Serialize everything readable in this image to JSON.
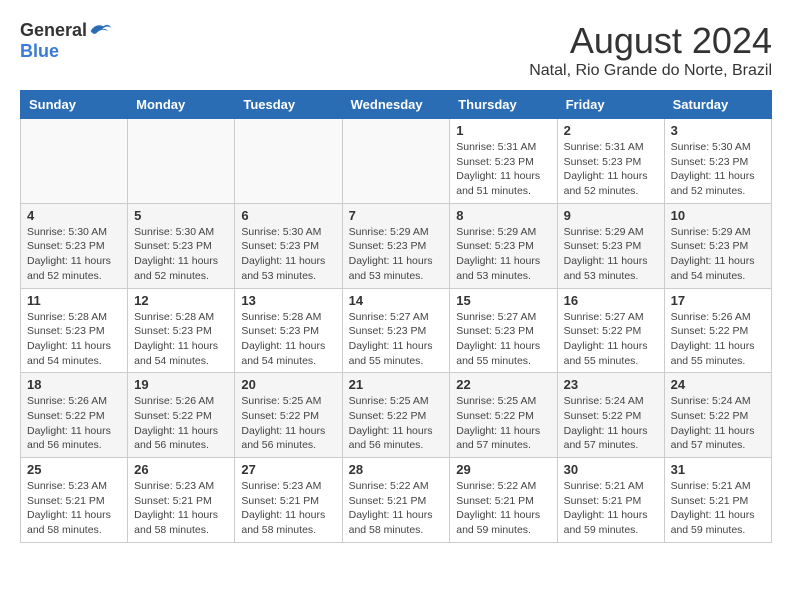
{
  "header": {
    "logo_general": "General",
    "logo_blue": "Blue",
    "month_year": "August 2024",
    "location": "Natal, Rio Grande do Norte, Brazil"
  },
  "calendar": {
    "headers": [
      "Sunday",
      "Monday",
      "Tuesday",
      "Wednesday",
      "Thursday",
      "Friday",
      "Saturday"
    ],
    "weeks": [
      [
        {
          "day": "",
          "info": ""
        },
        {
          "day": "",
          "info": ""
        },
        {
          "day": "",
          "info": ""
        },
        {
          "day": "",
          "info": ""
        },
        {
          "day": "1",
          "info": "Sunrise: 5:31 AM\nSunset: 5:23 PM\nDaylight: 11 hours and 51 minutes."
        },
        {
          "day": "2",
          "info": "Sunrise: 5:31 AM\nSunset: 5:23 PM\nDaylight: 11 hours and 52 minutes."
        },
        {
          "day": "3",
          "info": "Sunrise: 5:30 AM\nSunset: 5:23 PM\nDaylight: 11 hours and 52 minutes."
        }
      ],
      [
        {
          "day": "4",
          "info": "Sunrise: 5:30 AM\nSunset: 5:23 PM\nDaylight: 11 hours and 52 minutes."
        },
        {
          "day": "5",
          "info": "Sunrise: 5:30 AM\nSunset: 5:23 PM\nDaylight: 11 hours and 52 minutes."
        },
        {
          "day": "6",
          "info": "Sunrise: 5:30 AM\nSunset: 5:23 PM\nDaylight: 11 hours and 53 minutes."
        },
        {
          "day": "7",
          "info": "Sunrise: 5:29 AM\nSunset: 5:23 PM\nDaylight: 11 hours and 53 minutes."
        },
        {
          "day": "8",
          "info": "Sunrise: 5:29 AM\nSunset: 5:23 PM\nDaylight: 11 hours and 53 minutes."
        },
        {
          "day": "9",
          "info": "Sunrise: 5:29 AM\nSunset: 5:23 PM\nDaylight: 11 hours and 53 minutes."
        },
        {
          "day": "10",
          "info": "Sunrise: 5:29 AM\nSunset: 5:23 PM\nDaylight: 11 hours and 54 minutes."
        }
      ],
      [
        {
          "day": "11",
          "info": "Sunrise: 5:28 AM\nSunset: 5:23 PM\nDaylight: 11 hours and 54 minutes."
        },
        {
          "day": "12",
          "info": "Sunrise: 5:28 AM\nSunset: 5:23 PM\nDaylight: 11 hours and 54 minutes."
        },
        {
          "day": "13",
          "info": "Sunrise: 5:28 AM\nSunset: 5:23 PM\nDaylight: 11 hours and 54 minutes."
        },
        {
          "day": "14",
          "info": "Sunrise: 5:27 AM\nSunset: 5:23 PM\nDaylight: 11 hours and 55 minutes."
        },
        {
          "day": "15",
          "info": "Sunrise: 5:27 AM\nSunset: 5:23 PM\nDaylight: 11 hours and 55 minutes."
        },
        {
          "day": "16",
          "info": "Sunrise: 5:27 AM\nSunset: 5:22 PM\nDaylight: 11 hours and 55 minutes."
        },
        {
          "day": "17",
          "info": "Sunrise: 5:26 AM\nSunset: 5:22 PM\nDaylight: 11 hours and 55 minutes."
        }
      ],
      [
        {
          "day": "18",
          "info": "Sunrise: 5:26 AM\nSunset: 5:22 PM\nDaylight: 11 hours and 56 minutes."
        },
        {
          "day": "19",
          "info": "Sunrise: 5:26 AM\nSunset: 5:22 PM\nDaylight: 11 hours and 56 minutes."
        },
        {
          "day": "20",
          "info": "Sunrise: 5:25 AM\nSunset: 5:22 PM\nDaylight: 11 hours and 56 minutes."
        },
        {
          "day": "21",
          "info": "Sunrise: 5:25 AM\nSunset: 5:22 PM\nDaylight: 11 hours and 56 minutes."
        },
        {
          "day": "22",
          "info": "Sunrise: 5:25 AM\nSunset: 5:22 PM\nDaylight: 11 hours and 57 minutes."
        },
        {
          "day": "23",
          "info": "Sunrise: 5:24 AM\nSunset: 5:22 PM\nDaylight: 11 hours and 57 minutes."
        },
        {
          "day": "24",
          "info": "Sunrise: 5:24 AM\nSunset: 5:22 PM\nDaylight: 11 hours and 57 minutes."
        }
      ],
      [
        {
          "day": "25",
          "info": "Sunrise: 5:23 AM\nSunset: 5:21 PM\nDaylight: 11 hours and 58 minutes."
        },
        {
          "day": "26",
          "info": "Sunrise: 5:23 AM\nSunset: 5:21 PM\nDaylight: 11 hours and 58 minutes."
        },
        {
          "day": "27",
          "info": "Sunrise: 5:23 AM\nSunset: 5:21 PM\nDaylight: 11 hours and 58 minutes."
        },
        {
          "day": "28",
          "info": "Sunrise: 5:22 AM\nSunset: 5:21 PM\nDaylight: 11 hours and 58 minutes."
        },
        {
          "day": "29",
          "info": "Sunrise: 5:22 AM\nSunset: 5:21 PM\nDaylight: 11 hours and 59 minutes."
        },
        {
          "day": "30",
          "info": "Sunrise: 5:21 AM\nSunset: 5:21 PM\nDaylight: 11 hours and 59 minutes."
        },
        {
          "day": "31",
          "info": "Sunrise: 5:21 AM\nSunset: 5:21 PM\nDaylight: 11 hours and 59 minutes."
        }
      ]
    ]
  }
}
